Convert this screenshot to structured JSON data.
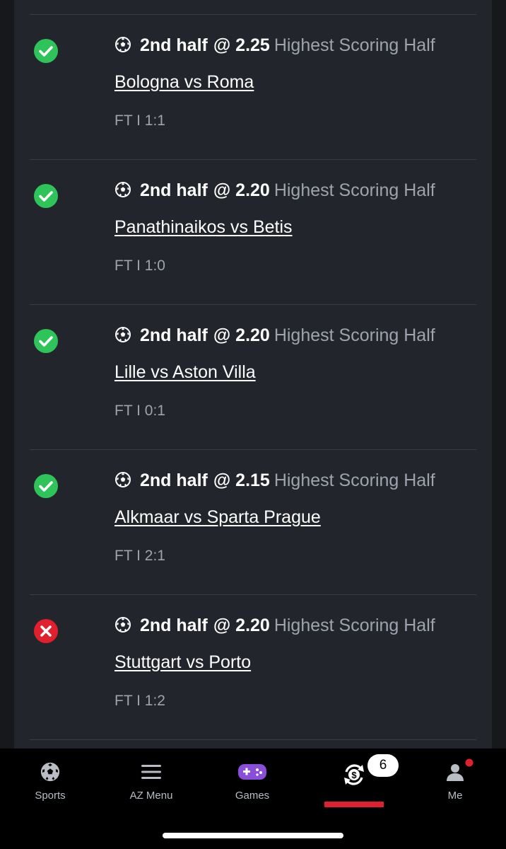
{
  "bets": [
    {
      "selection": "2nd half",
      "odds": "@ 2.25",
      "market": "Highest Scoring Half",
      "match": "Bologna vs Roma",
      "result": "FT I 1:1",
      "status": "won"
    },
    {
      "selection": "2nd half",
      "odds": "@ 2.20",
      "market": "Highest Scoring Half",
      "match": "Panathinaikos vs Betis",
      "result": "FT I 1:0",
      "status": "won"
    },
    {
      "selection": "2nd half",
      "odds": "@ 2.20",
      "market": "Highest Scoring Half",
      "match": "Lille vs Aston Villa",
      "result": "FT I 0:1",
      "status": "won"
    },
    {
      "selection": "2nd half",
      "odds": "@ 2.15",
      "market": "Highest Scoring Half",
      "match": "Alkmaar vs Sparta Prague",
      "result": "FT I 2:1",
      "status": "won"
    },
    {
      "selection": "2nd half",
      "odds": "@ 2.20",
      "market": "Highest Scoring Half",
      "match": "Stuttgart vs Porto",
      "result": "FT I 1:2",
      "status": "lost"
    }
  ],
  "nav": {
    "sports": "Sports",
    "menu": "AZ Menu",
    "games": "Games",
    "bets_badge": "6",
    "me": "Me"
  },
  "colors": {
    "won": "#2fc45a",
    "lost": "#e0202e",
    "accent": "#e0202e"
  },
  "icons": {
    "won": "check-icon",
    "lost": "x-icon",
    "sport": "soccer-ball-icon"
  }
}
